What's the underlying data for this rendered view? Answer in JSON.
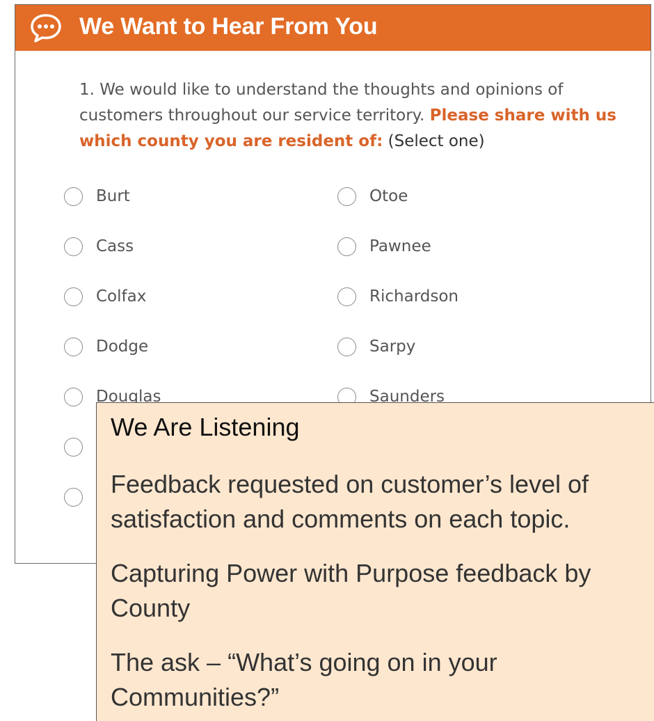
{
  "survey": {
    "title": "We Want to Hear From You",
    "icon": "chat-bubble-icon",
    "accent_color": "#e36c26",
    "question": {
      "intro": "1. We would like to understand the thoughts and opinions of customers throughout our service territory.",
      "emphasis": "Please share with us which county you are resident of:",
      "hint": "(Select one)"
    },
    "options_left": [
      "Burt",
      "Cass",
      "Colfax",
      "Dodge",
      "Douglas"
    ],
    "options_right": [
      "Otoe",
      "Pawnee",
      "Richardson",
      "Sarpy",
      "Saunders"
    ]
  },
  "callout": {
    "title": "We Are Listening",
    "background_color": "#fde7cf",
    "points": [
      "Feedback requested on customer’s level of satisfaction and comments on each topic.",
      "Capturing Power with Purpose feedback by County",
      "The ask – “What’s going on in your Communities?”"
    ]
  }
}
